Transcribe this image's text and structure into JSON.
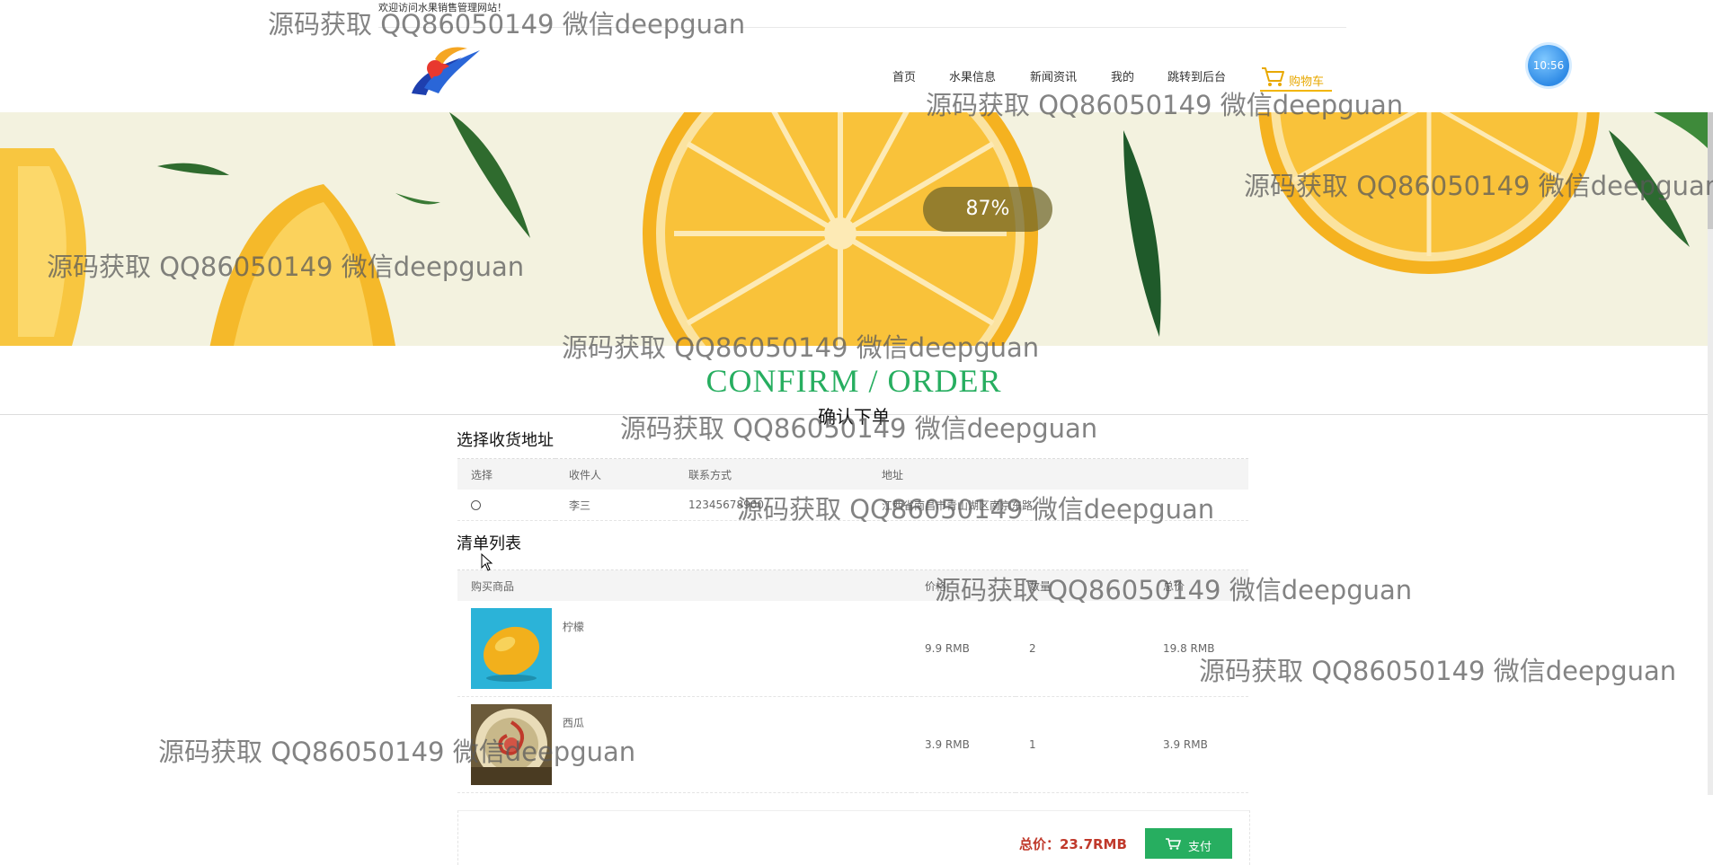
{
  "header": {
    "welcome": "欢迎访问水果销售管理网站！",
    "clock": "10:56"
  },
  "nav": {
    "items": [
      {
        "label": "首页"
      },
      {
        "label": "水果信息"
      },
      {
        "label": "新闻资讯"
      },
      {
        "label": "我的"
      },
      {
        "label": "跳转到后台"
      }
    ],
    "cart_label": "购物车"
  },
  "banner": {
    "progress": "87%"
  },
  "page": {
    "title_en": "CONFIRM / ORDER",
    "title_cn": "确认下单"
  },
  "address": {
    "section_title": "选择收货地址",
    "columns": [
      "选择",
      "收件人",
      "联系方式",
      "地址"
    ],
    "rows": [
      {
        "name": "李三",
        "phone": "12345678900",
        "address": "江西省南昌市青山湖区南京东路"
      }
    ]
  },
  "order": {
    "section_title": "清单列表",
    "columns": [
      "购买商品",
      "价格",
      "数量",
      "总价"
    ],
    "items": [
      {
        "name": "柠檬",
        "price": "9.9 RMB",
        "qty": "2",
        "total": "19.8 RMB"
      },
      {
        "name": "西瓜",
        "price": "3.9 RMB",
        "qty": "1",
        "total": "3.9 RMB"
      }
    ],
    "total_label": "总价：23.7RMB",
    "pay_label": "支付"
  },
  "watermark": "源码获取 QQ86050149 微信deepguan",
  "colors": {
    "accent_green": "#27ae60",
    "total_red": "#c0392b",
    "cart_yellow": "#e8a800"
  }
}
